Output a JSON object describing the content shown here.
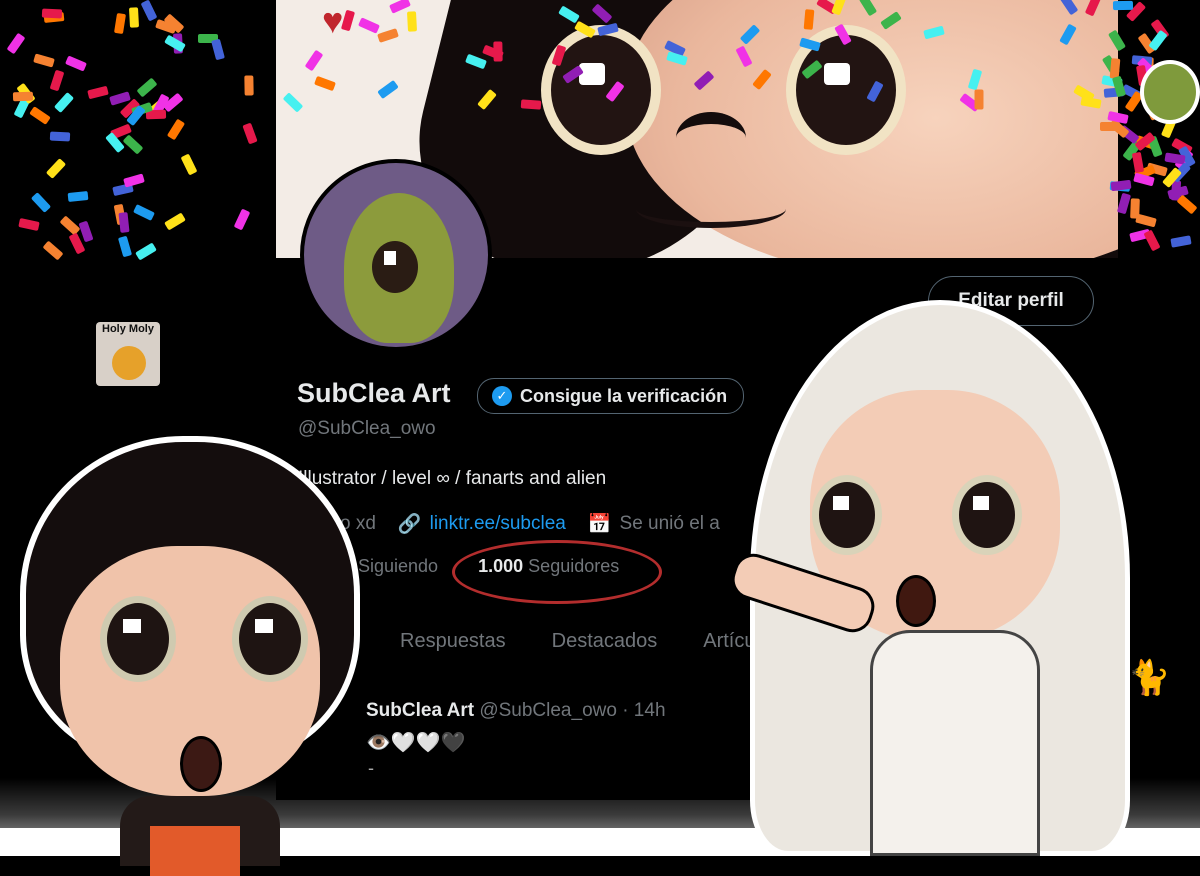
{
  "profile": {
    "name": "SubClea Art",
    "verify_label": "Consigue la verificación",
    "handle": "@SubClea_owo",
    "bio": "Illustrator / level ∞ / fanarts and alien",
    "location_partial": "o xd",
    "link": "linktr.ee/subclea",
    "joined_partial": "Se unió el a",
    "edit_button": "Editar perfil"
  },
  "stats": {
    "following_label": "Siguiendo",
    "followers_count": "1.000",
    "followers_label": "Seguidores"
  },
  "tabs": [
    "Respuestas",
    "Destacados",
    "Artículo"
  ],
  "tweet": {
    "author": "SubClea Art",
    "meta": "@SubClea_owo · 14h",
    "body": "👁️🤍🤍🖤",
    "dash": "-"
  },
  "sticker": {
    "holy_text": "Holy Moly"
  },
  "icons": {
    "verified": "verified-check-icon",
    "link": "link-icon",
    "calendar": "calendar-icon"
  },
  "colors": {
    "accent": "#1d9bf0",
    "highlight_circle": "#b32d2d"
  }
}
